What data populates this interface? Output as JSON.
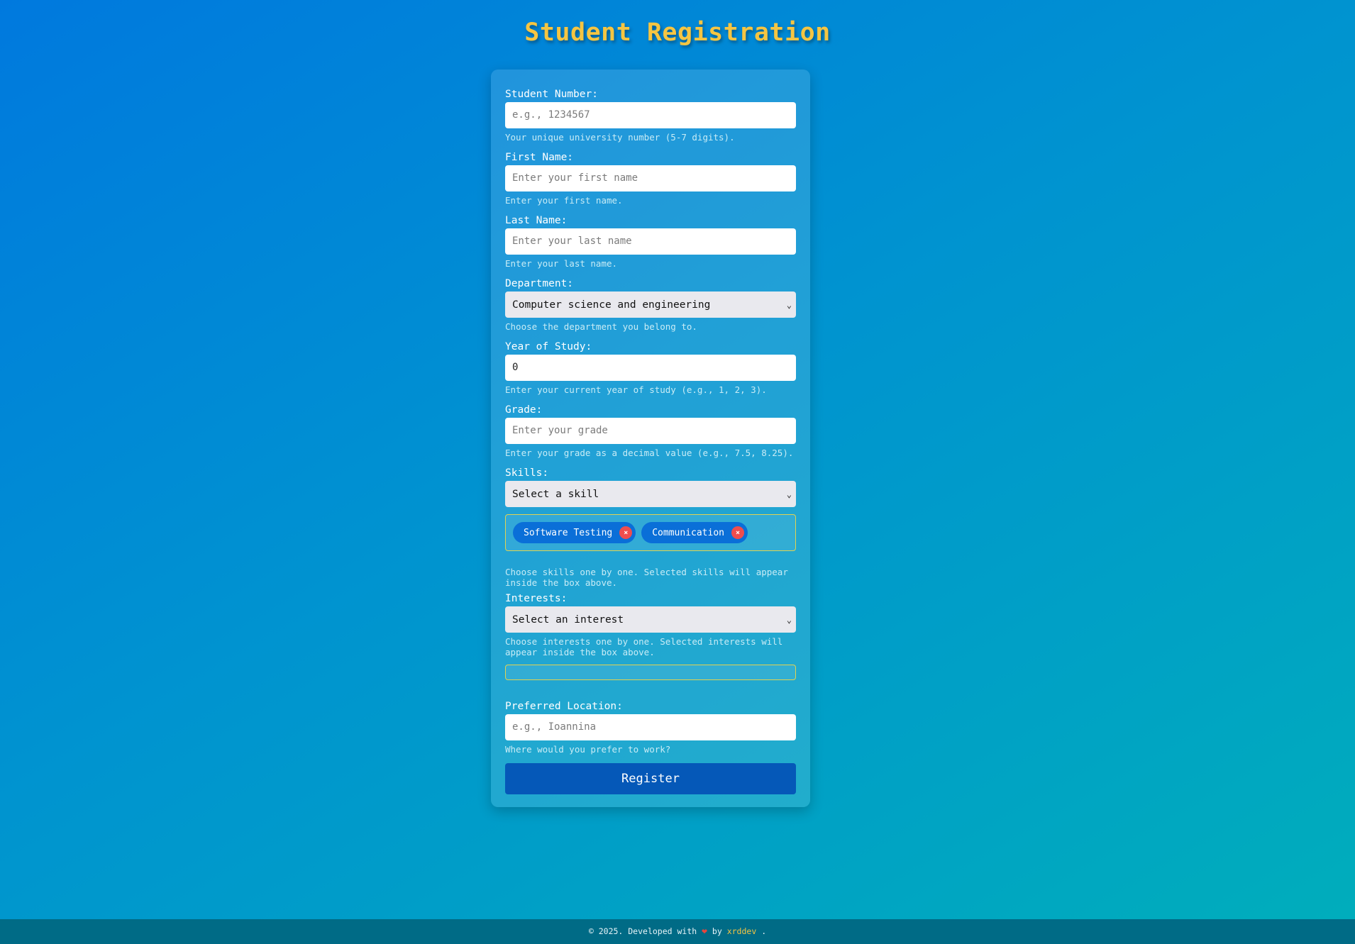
{
  "page": {
    "title": "Student Registration"
  },
  "form": {
    "student_number": {
      "label": "Student Number:",
      "placeholder": "e.g., 1234567",
      "hint": "Your unique university number (5-7 digits)."
    },
    "first_name": {
      "label": "First Name:",
      "placeholder": "Enter your first name",
      "hint": "Enter your first name."
    },
    "last_name": {
      "label": "Last Name:",
      "placeholder": "Enter your last name",
      "hint": "Enter your last name."
    },
    "department": {
      "label": "Department:",
      "value": "Computer science and engineering",
      "hint": "Choose the department you belong to."
    },
    "year": {
      "label": "Year of Study:",
      "value": "0",
      "hint": "Enter your current year of study (e.g., 1, 2, 3)."
    },
    "grade": {
      "label": "Grade:",
      "placeholder": "Enter your grade",
      "hint": "Enter your grade as a decimal value (e.g., 7.5, 8.25)."
    },
    "skills": {
      "label": "Skills:",
      "value": "Select a skill",
      "selected": [
        "Software Testing",
        "Communication"
      ],
      "remove_glyph": "×",
      "hint": "Choose skills one by one. Selected skills will appear inside the box above."
    },
    "interests": {
      "label": "Interests:",
      "value": "Select an interest",
      "hint": "Choose interests one by one. Selected interests will appear inside the box above."
    },
    "location": {
      "label": "Preferred Location:",
      "placeholder": "e.g., Ioannina",
      "hint": "Where would you prefer to work?"
    },
    "submit_label": "Register"
  },
  "footer": {
    "prefix": "© 2025. Developed with",
    "heart": "❤",
    "by": "by",
    "author": "xrddev",
    "suffix": "."
  },
  "colors": {
    "title": "#f5c542",
    "button": "#0558b8",
    "tag": "#0a6fd8",
    "tag_remove": "#ef4d4d",
    "box_border": "#e2d350"
  }
}
